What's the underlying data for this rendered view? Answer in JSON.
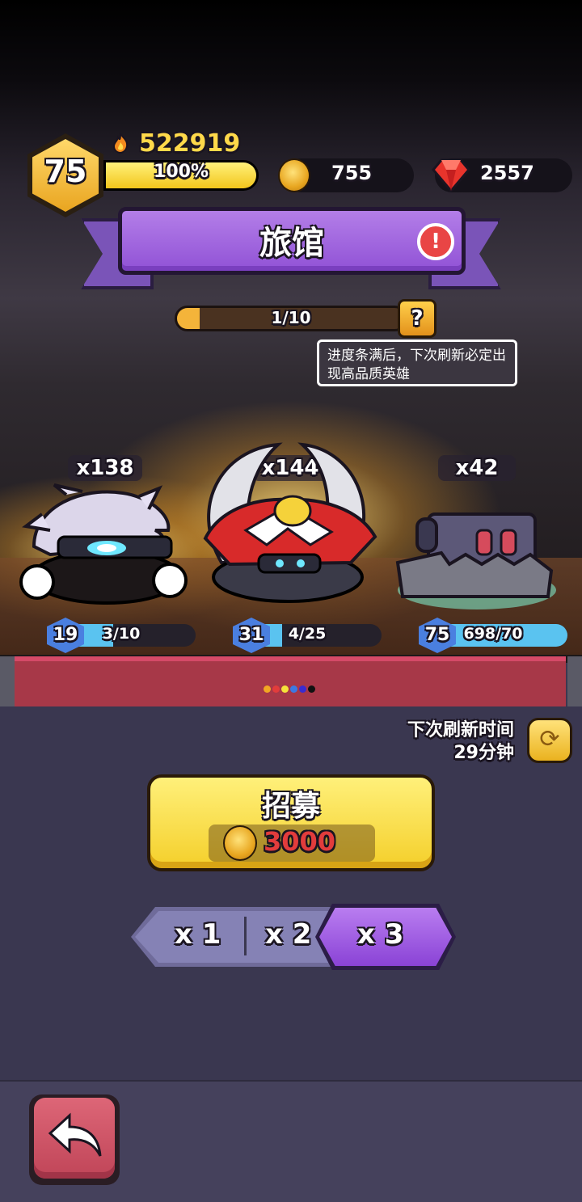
{
  "player": {
    "level": "75",
    "power": "522919",
    "xp_percent": 1.0,
    "xp_text": "100%"
  },
  "resources": {
    "coins": "755",
    "gems": "2557"
  },
  "title": "旅馆",
  "progress": {
    "text": "1/10",
    "fraction": 0.1
  },
  "tooltip": "进度条满后，下次刷新必定出现高品质英雄",
  "heroes": [
    {
      "count": "x138",
      "level": "19",
      "shards": "3/10",
      "fraction": 0.3
    },
    {
      "count": "x144",
      "level": "31",
      "shards": "4/25",
      "fraction": 0.16
    },
    {
      "count": "x42",
      "level": "75",
      "shards": "698/70",
      "fraction": 1.0
    }
  ],
  "refresh": {
    "label": "下次刷新时间",
    "time": "29分钟"
  },
  "recruit": {
    "label": "招募",
    "cost": "3000"
  },
  "multipliers": [
    "x 1",
    "x 2",
    "x 3"
  ],
  "selected_multiplier": "x 3",
  "page_dots": [
    "#f2a623",
    "#e23c3c",
    "#f5e23a",
    "#3c79e2",
    "#3a2bd0",
    "#111111"
  ],
  "colors": {
    "accent_purple": "#9152d6",
    "gold": "#f4cf2a",
    "alert_red": "#e94545"
  }
}
